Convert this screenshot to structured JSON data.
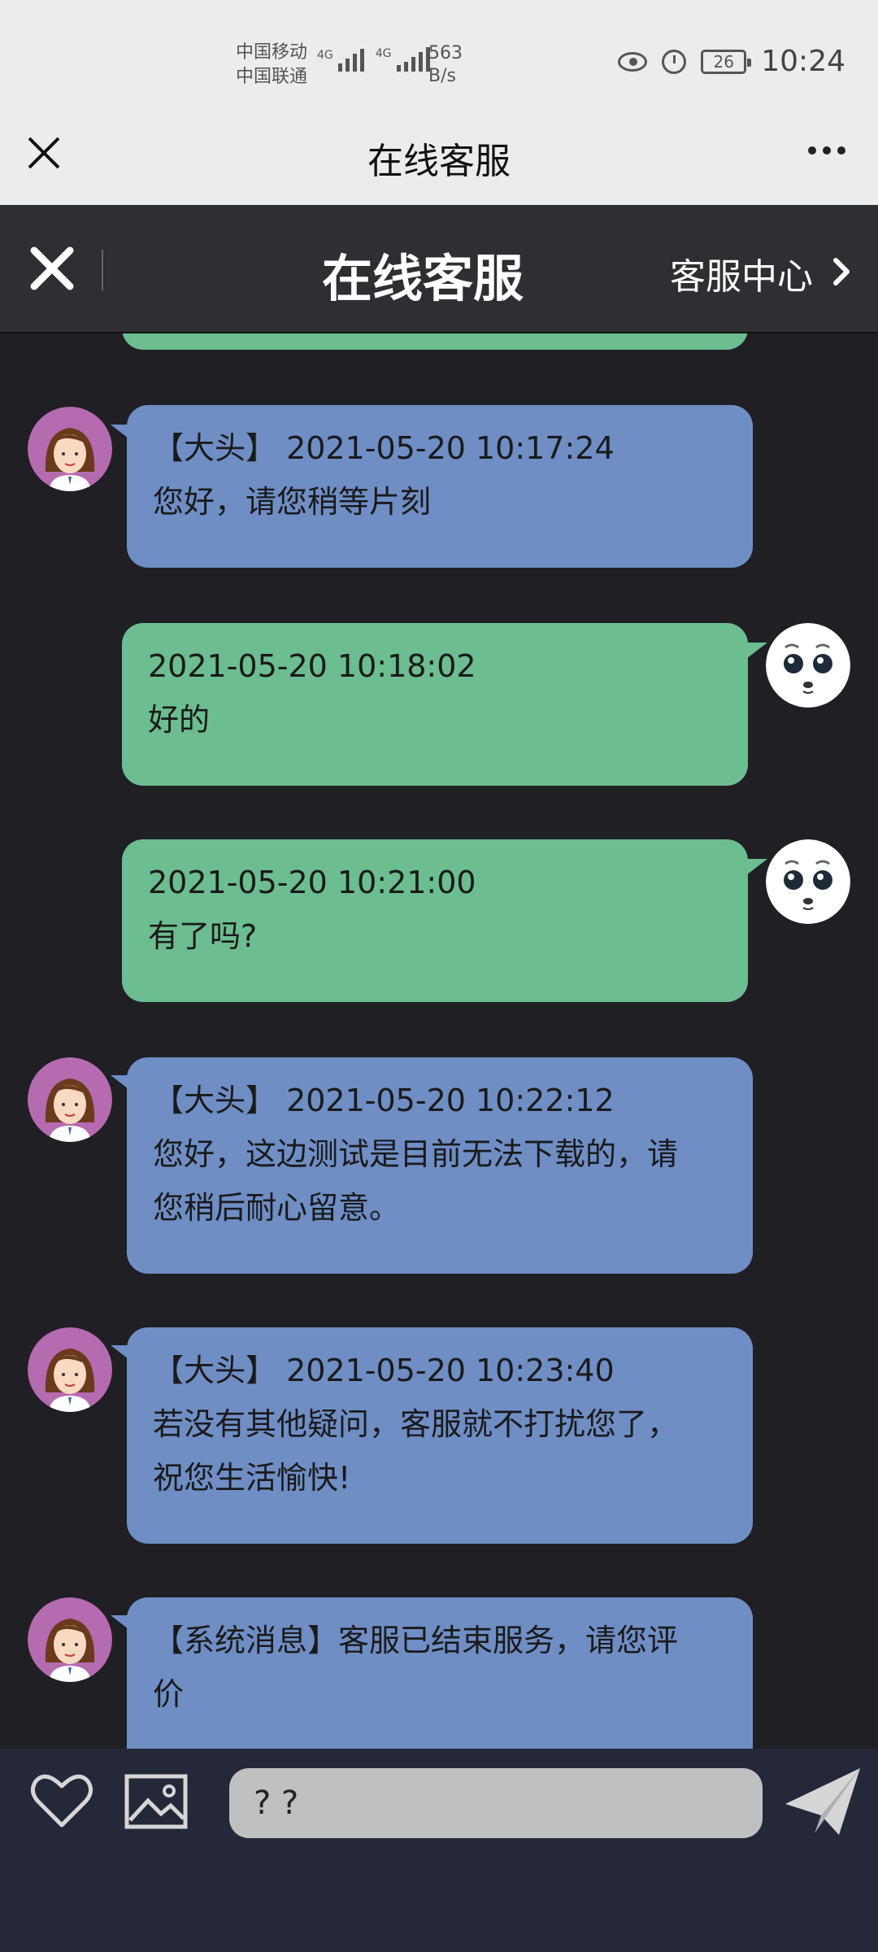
{
  "status_bar": {
    "carrier_1": "中国移动",
    "carrier_2": "中国联通",
    "net_1": "4G",
    "net_2": "4G",
    "speed_value": "563",
    "speed_unit": "B/s",
    "battery": "26",
    "time": "10:24"
  },
  "title_bar": {
    "title": "在线客服"
  },
  "inner_header": {
    "title": "在线客服",
    "service_center": "客服中心"
  },
  "messages": [
    {
      "sender": "agent",
      "header": "【大头】 2021-05-20 10:17:24",
      "text": "您好，请您稍等片刻"
    },
    {
      "sender": "user",
      "header": "2021-05-20 10:18:02",
      "text": "好的"
    },
    {
      "sender": "user",
      "header": "2021-05-20 10:21:00",
      "text": "有了吗?"
    },
    {
      "sender": "agent",
      "header": "【大头】 2021-05-20 10:22:12",
      "text_line_1": "您好，这边测试是目前无法下载的，请",
      "text_line_2": "您稍后耐心留意。"
    },
    {
      "sender": "agent",
      "header": "【大头】 2021-05-20 10:23:40",
      "text_line_1": "若没有其他疑问，客服就不打扰您了，",
      "text_line_2": "祝您生活愉快!"
    },
    {
      "sender": "agent",
      "text_line_1": "【系统消息】客服已结束服务，请您评",
      "text_line_2": "价"
    }
  ],
  "input": {
    "value": "? ?"
  },
  "colors": {
    "agent_bubble": "#6e8ec4",
    "user_bubble": "#6cbd8f",
    "chat_background": "#1f1f24",
    "bottom_bar": "#242838"
  }
}
